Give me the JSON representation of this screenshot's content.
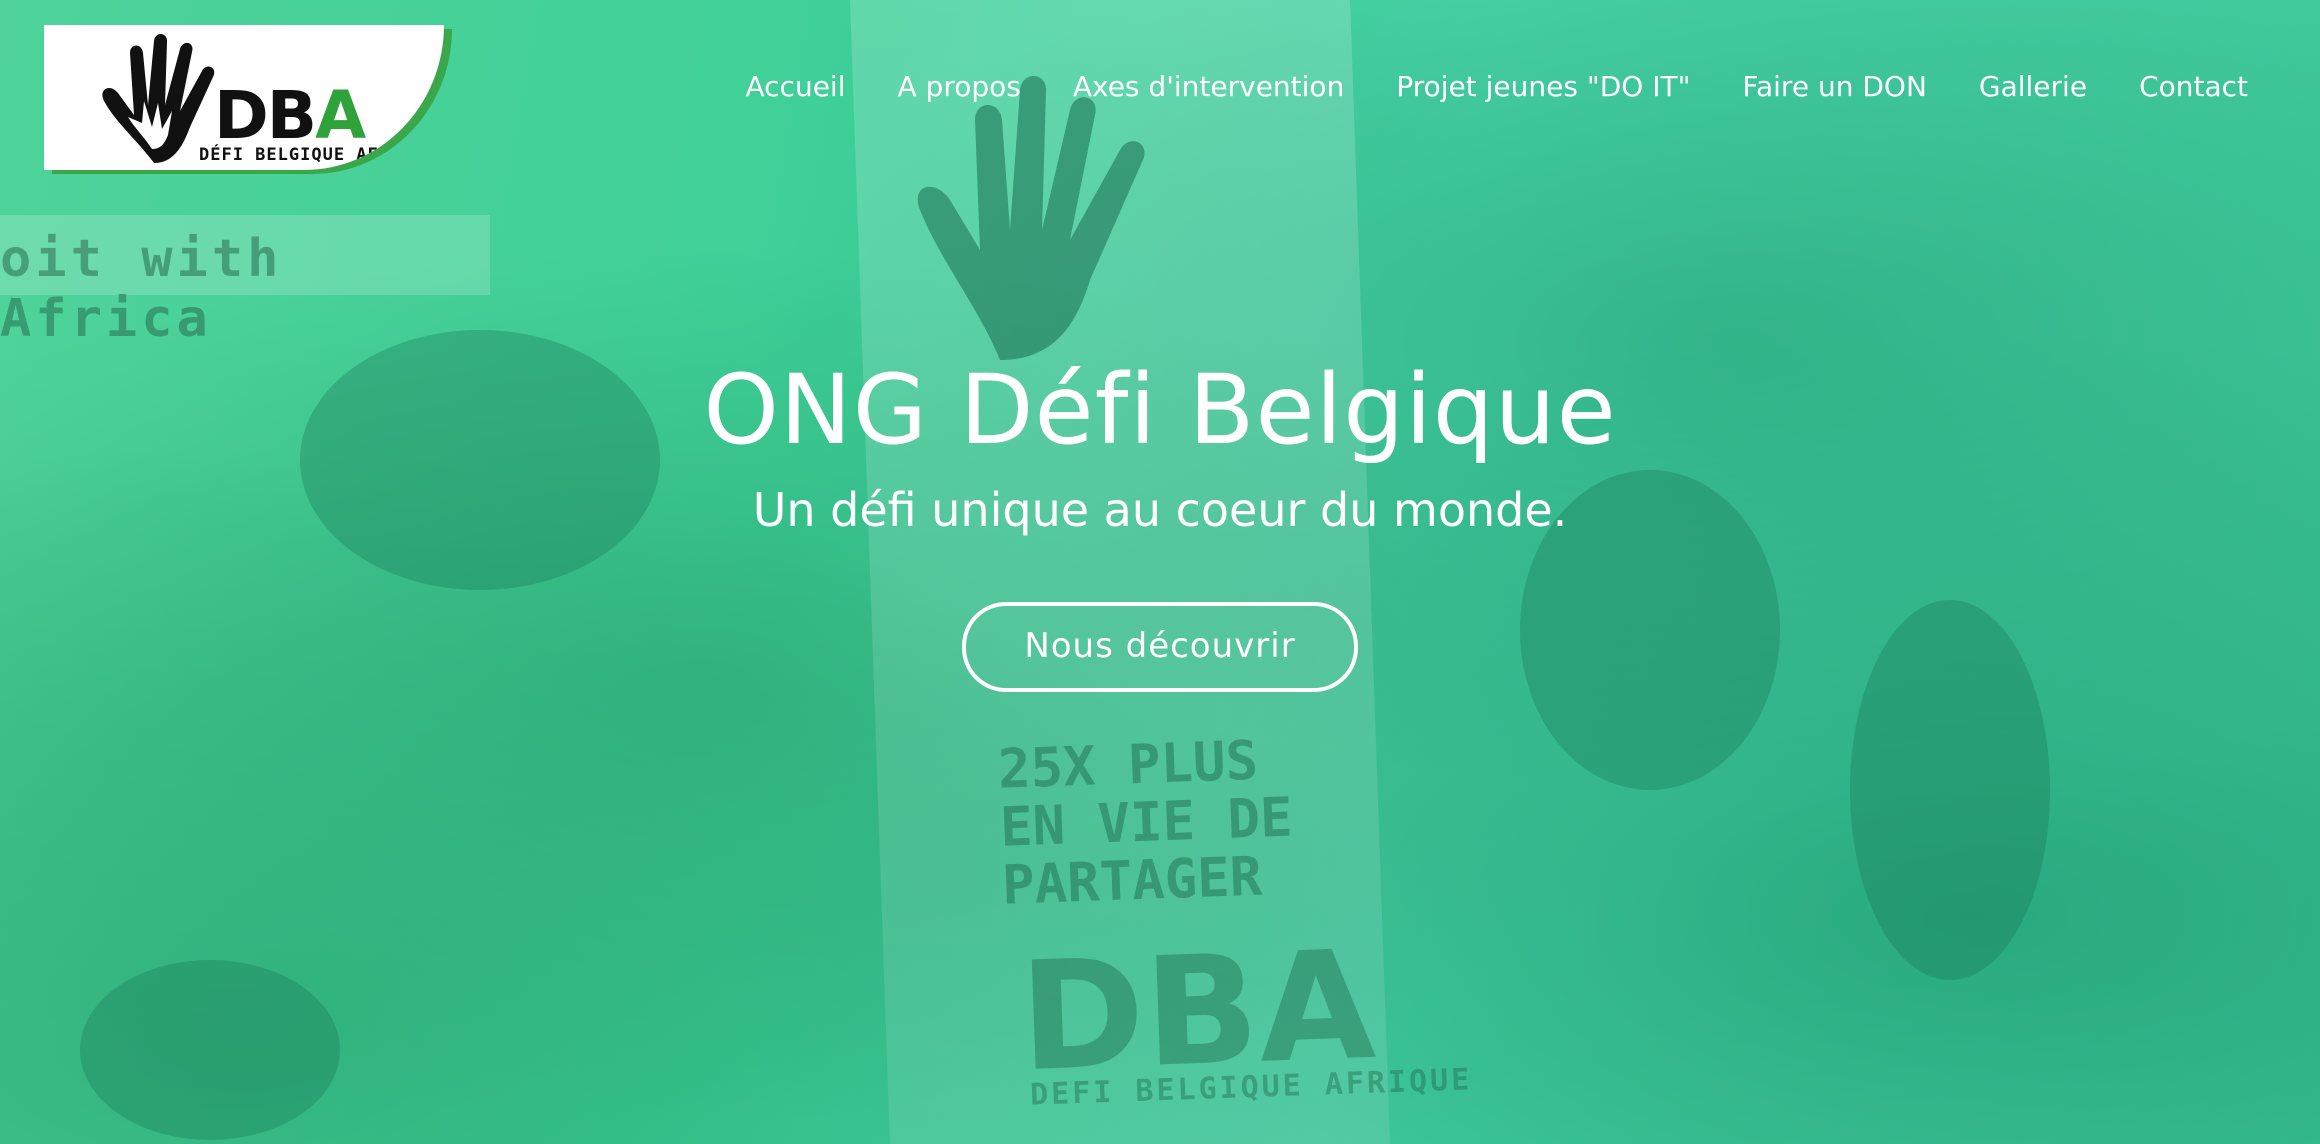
{
  "logo": {
    "letters_black": "DB",
    "letter_green": "A",
    "subtitle": "DÉFI BELGIQUE AFRIQUE"
  },
  "nav": {
    "items": [
      {
        "label": "Accueil"
      },
      {
        "label": "A propos"
      },
      {
        "label": "Axes d'intervention"
      },
      {
        "label": "Projet jeunes \"DO IT\""
      },
      {
        "label": "Faire un DON"
      },
      {
        "label": "Gallerie"
      },
      {
        "label": "Contact"
      }
    ]
  },
  "hero": {
    "title": "ONG Défi Belgique",
    "subtitle": "Un défi unique au coeur du monde.",
    "cta_label": "Nous découvrir"
  },
  "background": {
    "banner_text": "oit with Africa",
    "poster_lines": [
      "25X PLUS",
      "EN VIE DE",
      "PARTAGER"
    ],
    "poster_logo": "DBA",
    "poster_logo_sub": "DEFI BELGIQUE AFRIQUE"
  },
  "colors": {
    "overlay": "#3fcf9a",
    "logo_green": "#2fa23a",
    "text": "#ffffff"
  }
}
